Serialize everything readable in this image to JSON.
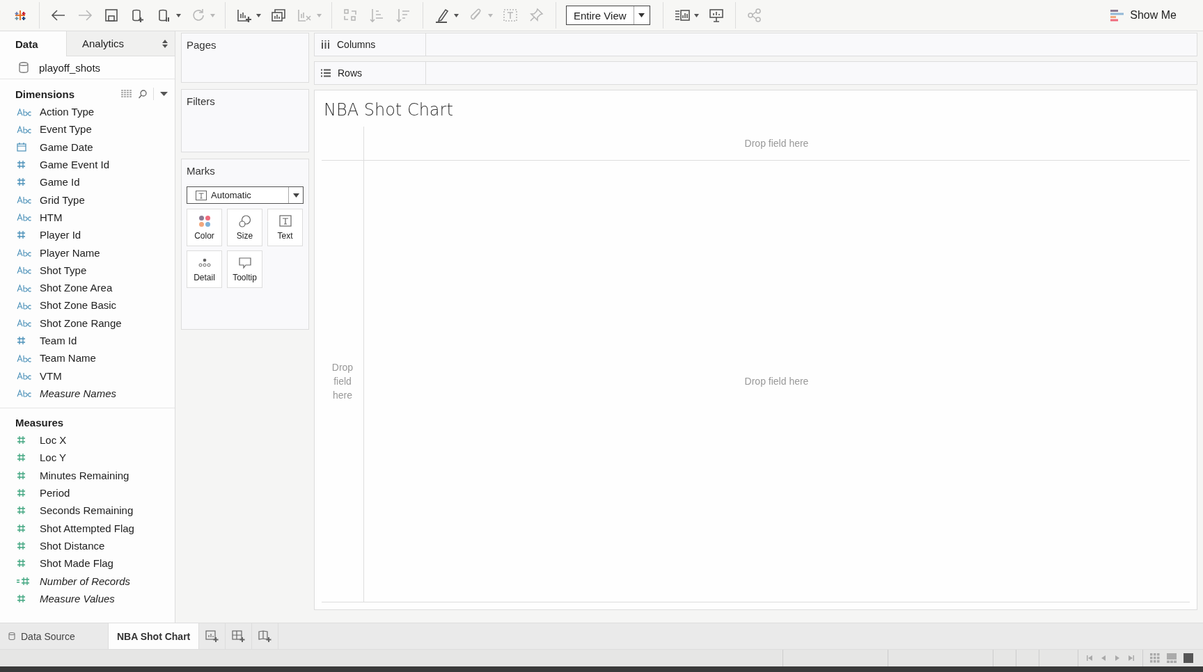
{
  "toolbar": {
    "items": [
      {
        "kind": "logo",
        "disabled": false,
        "dropdown": false
      },
      {
        "kind": "back",
        "disabled": false,
        "dropdown": false
      },
      {
        "kind": "forward",
        "disabled": true,
        "dropdown": false
      },
      {
        "kind": "save",
        "disabled": false,
        "dropdown": false
      },
      {
        "kind": "add-data",
        "disabled": false,
        "dropdown": false
      },
      {
        "kind": "pause-data",
        "disabled": false,
        "dropdown": true
      },
      {
        "kind": "refresh",
        "disabled": true,
        "dropdown": true
      },
      {
        "kind": "new-sheet",
        "disabled": false,
        "dropdown": true
      },
      {
        "kind": "duplicate",
        "disabled": false,
        "dropdown": false
      },
      {
        "kind": "clear",
        "disabled": true,
        "dropdown": true
      },
      {
        "kind": "swap",
        "disabled": true,
        "dropdown": false
      },
      {
        "kind": "sort-asc",
        "disabled": true,
        "dropdown": false
      },
      {
        "kind": "sort-desc",
        "disabled": true,
        "dropdown": false
      },
      {
        "kind": "highlight",
        "disabled": false,
        "dropdown": true
      },
      {
        "kind": "annotate",
        "disabled": true,
        "dropdown": true
      },
      {
        "kind": "labels",
        "disabled": true,
        "dropdown": false
      },
      {
        "kind": "pin",
        "disabled": true,
        "dropdown": false
      },
      {
        "kind": "fit",
        "label": "Entire View",
        "disabled": false,
        "dropdown": true
      },
      {
        "kind": "cards",
        "disabled": false,
        "dropdown": true
      },
      {
        "kind": "present",
        "disabled": false,
        "dropdown": false
      },
      {
        "kind": "share",
        "disabled": true,
        "dropdown": false
      }
    ],
    "show_me": "Show Me"
  },
  "data_pane": {
    "tabs": [
      {
        "label": "Data",
        "selected": true
      },
      {
        "label": "Analytics",
        "selected": false
      }
    ],
    "datasource": "playoff_shots",
    "dimensions": {
      "title": "Dimensions",
      "fields": [
        {
          "name": "Action Type",
          "kind": "string",
          "generated": false
        },
        {
          "name": "Event Type",
          "kind": "string",
          "generated": false
        },
        {
          "name": "Game Date",
          "kind": "date",
          "generated": false
        },
        {
          "name": "Game Event Id",
          "kind": "number",
          "generated": false
        },
        {
          "name": "Game Id",
          "kind": "number",
          "generated": false
        },
        {
          "name": "Grid Type",
          "kind": "string",
          "generated": false
        },
        {
          "name": "HTM",
          "kind": "string",
          "generated": false
        },
        {
          "name": "Player Id",
          "kind": "number",
          "generated": false
        },
        {
          "name": "Player Name",
          "kind": "string",
          "generated": false
        },
        {
          "name": "Shot Type",
          "kind": "string",
          "generated": false
        },
        {
          "name": "Shot Zone Area",
          "kind": "string",
          "generated": false
        },
        {
          "name": "Shot Zone Basic",
          "kind": "string",
          "generated": false
        },
        {
          "name": "Shot Zone Range",
          "kind": "string",
          "generated": false
        },
        {
          "name": "Team Id",
          "kind": "number",
          "generated": false
        },
        {
          "name": "Team Name",
          "kind": "string",
          "generated": false
        },
        {
          "name": "VTM",
          "kind": "string",
          "generated": false
        },
        {
          "name": "Measure Names",
          "kind": "string",
          "generated": true
        }
      ]
    },
    "measures": {
      "title": "Measures",
      "fields": [
        {
          "name": "Loc X",
          "kind": "measure",
          "generated": false
        },
        {
          "name": "Loc Y",
          "kind": "measure",
          "generated": false
        },
        {
          "name": "Minutes Remaining",
          "kind": "measure",
          "generated": false
        },
        {
          "name": "Period",
          "kind": "measure",
          "generated": false
        },
        {
          "name": "Seconds Remaining",
          "kind": "measure",
          "generated": false
        },
        {
          "name": "Shot Attempted Flag",
          "kind": "measure",
          "generated": false
        },
        {
          "name": "Shot Distance",
          "kind": "measure",
          "generated": false
        },
        {
          "name": "Shot Made Flag",
          "kind": "measure",
          "generated": false
        },
        {
          "name": "Number of Records",
          "kind": "calculated",
          "generated": true
        },
        {
          "name": "Measure Values",
          "kind": "measure",
          "generated": true
        }
      ]
    }
  },
  "cards": {
    "pages": "Pages",
    "filters": "Filters",
    "marks": {
      "title": "Marks",
      "type": "Automatic",
      "buttons": [
        {
          "label": "Color",
          "kind": "color"
        },
        {
          "label": "Size",
          "kind": "size"
        },
        {
          "label": "Text",
          "kind": "text"
        },
        {
          "label": "Detail",
          "kind": "detail"
        },
        {
          "label": "Tooltip",
          "kind": "tooltip"
        }
      ]
    }
  },
  "shelves": [
    {
      "label": "Columns",
      "kind": "columns"
    },
    {
      "label": "Rows",
      "kind": "rows"
    }
  ],
  "sheet": {
    "title": "NBA Shot Chart",
    "drop_top": "Drop field here",
    "drop_left": "Drop field here",
    "drop_center": "Drop field here"
  },
  "bottom_tabs": [
    {
      "label": "Data Source",
      "kind": "datasource",
      "selected": false
    },
    {
      "label": "NBA Shot Chart",
      "kind": "sheet",
      "selected": true
    }
  ],
  "new_tabs": [
    {
      "kind": "new-worksheet"
    },
    {
      "kind": "new-dashboard"
    },
    {
      "kind": "new-story"
    }
  ],
  "status_bar": {
    "nav": [
      {
        "kind": "first"
      },
      {
        "kind": "prev"
      },
      {
        "kind": "next"
      },
      {
        "kind": "last"
      }
    ],
    "views": [
      {
        "kind": "grid",
        "selected": false
      },
      {
        "kind": "filmstrip",
        "selected": false
      },
      {
        "kind": "single",
        "selected": true
      }
    ]
  }
}
